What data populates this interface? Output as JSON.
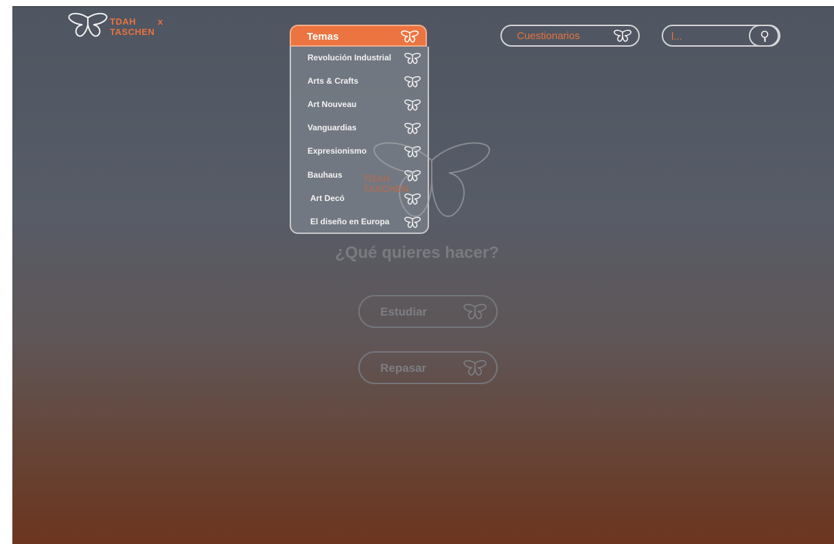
{
  "brand": {
    "line1": "TDAH",
    "line2": "TASCHEN",
    "x": "x",
    "color": "#e8723f"
  },
  "nav": {
    "temas_label": "Temas",
    "temas_items": [
      "Revolución Industrial",
      "Arts & Crafts",
      "Art Nouveau",
      "Vanguardias",
      "Expresionismo",
      "Bauhaus",
      "Art Decó",
      "El diseño en Europa"
    ],
    "cuestionarios_label": "Cuestionarios",
    "search_placeholder": "l..."
  },
  "main": {
    "center_logo_line1": "TDAH",
    "center_logo_line2": "TASCHEN",
    "question": "¿Qué quieres hacer?",
    "buttons": [
      "Estudiar",
      "Repasar"
    ]
  },
  "icons": {
    "butterfly": "butterfly-icon",
    "search": "magnifier-icon"
  },
  "colors": {
    "accent": "#ec7440",
    "outline": "#d7d7d9"
  }
}
